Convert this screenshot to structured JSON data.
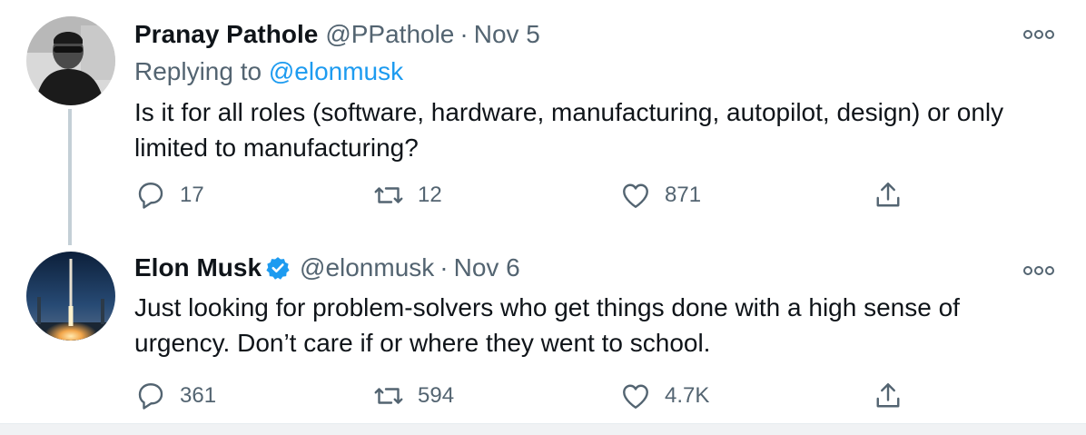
{
  "tweets": [
    {
      "author_name": "Pranay Pathole",
      "handle": "@PPathole",
      "separator": "·",
      "date": "Nov 5",
      "replying_prefix": "Replying to",
      "replying_to": "@elonmusk",
      "text": "Is it for all roles (software, hardware, manufacturing, autopilot, design) or only limited to manufacturing?",
      "stats": {
        "replies": "17",
        "retweets": "12",
        "likes": "871"
      },
      "verified": false
    },
    {
      "author_name": "Elon Musk",
      "handle": "@elonmusk",
      "separator": "·",
      "date": "Nov 6",
      "text": "Just looking for problem-solvers who get things done with a high sense of urgency. Don’t care if or where they went to school.",
      "stats": {
        "replies": "361",
        "retweets": "594",
        "likes": "4.7K"
      },
      "verified": true
    }
  ],
  "icons": {
    "reply": "reply-icon",
    "retweet": "retweet-icon",
    "like": "heart-icon",
    "share": "share-icon",
    "more": "more-icon",
    "verified": "verified-badge-icon"
  },
  "colors": {
    "text": "#0f1419",
    "muted": "#536471",
    "link": "#1d9bf0",
    "verified": "#1d9bf0",
    "thread_line": "#c4cfd6"
  }
}
